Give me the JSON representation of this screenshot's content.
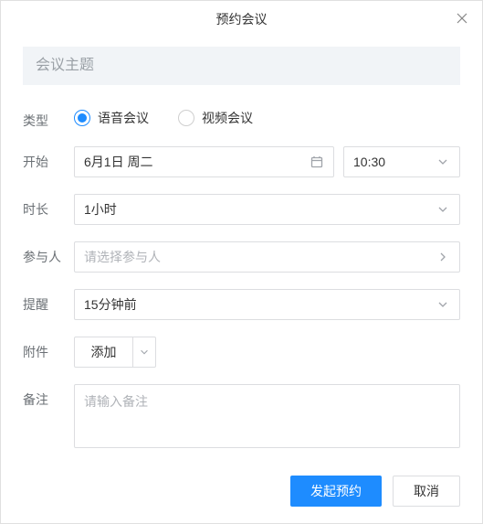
{
  "window_title": "预约会议",
  "topic": {
    "placeholder": "会议主题",
    "value": ""
  },
  "labels": {
    "type": "类型",
    "start": "开始",
    "duration": "时长",
    "participants": "参与人",
    "reminder": "提醒",
    "attachment": "附件",
    "remark": "备注"
  },
  "type_options": {
    "voice": "语音会议",
    "video": "视频会议",
    "selected": "voice"
  },
  "start": {
    "date": "6月1日 周二",
    "time": "10:30"
  },
  "duration": {
    "value": "1小时"
  },
  "participants": {
    "placeholder": "请选择参与人",
    "value": ""
  },
  "reminder": {
    "value": "15分钟前"
  },
  "attachment": {
    "label": "添加"
  },
  "remark": {
    "placeholder": "请输入备注",
    "value": ""
  },
  "buttons": {
    "submit": "发起预约",
    "cancel": "取消"
  }
}
